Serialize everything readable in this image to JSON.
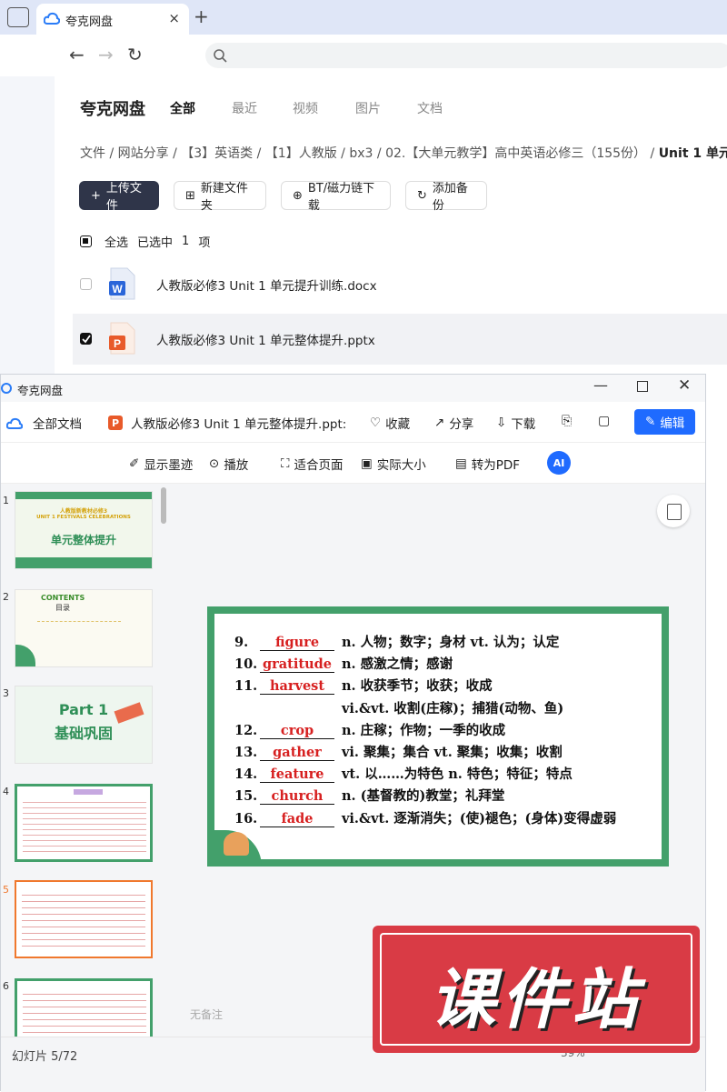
{
  "browser": {
    "tab_title": "夸克网盘",
    "new_tab": "+",
    "close_tab": "×"
  },
  "pan": {
    "brand": "夸克网盘",
    "tabs": [
      "全部",
      "最近",
      "视频",
      "图片",
      "文档"
    ],
    "breadcrumb": {
      "items": [
        "文件",
        "网站分享",
        "【3】英语类",
        "【1】人教版",
        "bx3",
        "02.【大单元教学】高中英语必修三（155份）"
      ],
      "current": "Unit 1 单元"
    },
    "actions": {
      "upload": "上传文件",
      "new_folder": "新建文件夹",
      "bt": "BT/磁力链下载",
      "backup": "添加备份"
    },
    "selection": {
      "select_all": "全选",
      "selected_prefix": "已选中",
      "count": "1",
      "unit": "项"
    },
    "files": [
      {
        "name": "人教版必修3 Unit 1 单元提升训练.docx",
        "type": "docx",
        "checked": false
      },
      {
        "name": "人教版必修3 Unit 1 单元整体提升.pptx",
        "type": "pptx",
        "checked": true
      }
    ]
  },
  "viewer": {
    "window_title": "夸克网盘",
    "all_docs": "全部文档",
    "doc_name": "人教版必修3 Unit 1 单元整体提升.ppt:",
    "favorite": "收藏",
    "share": "分享",
    "download": "下载",
    "edit": "编辑",
    "tools": {
      "ink": "显示墨迹",
      "play": "播放",
      "fit": "适合页面",
      "actual": "实际大小",
      "to_pdf": "转为PDF",
      "ai": "AI"
    },
    "no_notes": "无备注",
    "slide_counter": "幻灯片 5/72",
    "zoom": "39%",
    "thumbs": [
      {
        "num": "1",
        "title": "人教版新教材必修3",
        "subtitle": "UNIT 1 FESTIVALS CELEBRATIONS",
        "main": "单元整体提升"
      },
      {
        "num": "2",
        "title": "CONTENTS",
        "subtitle": "目录"
      },
      {
        "num": "3",
        "title": "Part 1",
        "subtitle": "基础巩固"
      },
      {
        "num": "4",
        "title": ""
      },
      {
        "num": "5",
        "title": ""
      },
      {
        "num": "6",
        "title": ""
      }
    ]
  },
  "slide": {
    "lines": [
      {
        "num": "9.",
        "answer": "figure",
        "text": "n. 人物；数字；身材  vt. 认为；认定"
      },
      {
        "num": "10.",
        "answer": "gratitude",
        "text": "n. 感激之情；感谢"
      },
      {
        "num": "11.",
        "answer": "harvest",
        "text": "n. 收获季节；收获；收成"
      },
      {
        "num": "",
        "answer": "",
        "text": "vi.&vt. 收割(庄稼)；捕猎(动物、鱼)"
      },
      {
        "num": "12.",
        "answer": "crop",
        "text": "n. 庄稼；作物；一季的收成"
      },
      {
        "num": "13.",
        "answer": "gather",
        "text": "vi. 聚集；集合  vt. 聚集；收集；收割"
      },
      {
        "num": "14.",
        "answer": "feature",
        "text": "vt. 以……为特色  n. 特色；特征；特点"
      },
      {
        "num": "15.",
        "answer": "church",
        "text": "n. (基督教的)教堂；礼拜堂"
      },
      {
        "num": "16.",
        "answer": "fade",
        "text": "vi.&vt.  逐渐消失；(使)褪色；(身体)变得虚弱"
      }
    ]
  },
  "watermark": "课件站",
  "colors": {
    "accent": "#1f6bff",
    "slide_green": "#43a06b",
    "answer_red": "#d72020",
    "stamp": "#d93b45"
  }
}
